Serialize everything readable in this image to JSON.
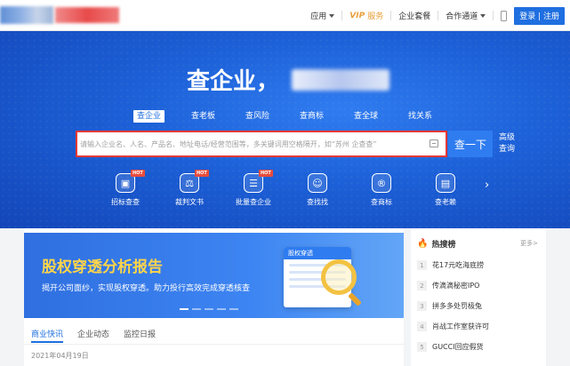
{
  "topbar": {
    "nav": [
      {
        "label": "应用",
        "caret": true
      },
      {
        "vip": "VIP",
        "label": "服务"
      },
      {
        "label": "企业套餐"
      },
      {
        "label": "合作通道",
        "caret": true
      }
    ],
    "login": "登录 | 注册"
  },
  "hero": {
    "title": "查企业，",
    "tabs": [
      "查企业",
      "查老板",
      "查风险",
      "查商标",
      "查全球",
      "找关系"
    ],
    "search_placeholder": "请输入企业名、人名、产品名、地址电话/经营范围等，多关键词用空格隔开，如“苏州 企查查”",
    "search_button": "查一下",
    "advanced": "高级查询",
    "icons": [
      {
        "label": "招标查查",
        "icon": "bid-icon",
        "glyph": "▣",
        "hot": true
      },
      {
        "label": "裁判文书",
        "icon": "judgment-icon",
        "glyph": "⚖",
        "hot": true
      },
      {
        "label": "批量查企业",
        "icon": "batch-icon",
        "glyph": "☰",
        "hot": true
      },
      {
        "label": "查找找",
        "icon": "find-people-icon",
        "glyph": "☺",
        "hot": false
      },
      {
        "label": "查商标",
        "icon": "trademark-icon",
        "glyph": "®",
        "hot": false
      },
      {
        "label": "查老赖",
        "icon": "deadbeat-icon",
        "glyph": "▤",
        "hot": false
      }
    ],
    "hot_badge": "HOT"
  },
  "banner": {
    "title": "股权穿透分析报告",
    "subtitle": "揭开公司面纱，实现股权穿透。助力投行高效完成穿透核查",
    "doc_label": "股权穿透"
  },
  "content": {
    "tabs": [
      "商业快讯",
      "企业动态",
      "监控日报"
    ],
    "date": "2021年04月19日"
  },
  "hotlist": {
    "title": "热搜榜",
    "more": "更多>",
    "items": [
      {
        "num": "1",
        "text": "花17元吃海底捞"
      },
      {
        "num": "2",
        "text": "传滴滴秘密IPO"
      },
      {
        "num": "3",
        "text": "拼多多处罚极兔"
      },
      {
        "num": "4",
        "text": "肖战工作室获许可"
      },
      {
        "num": "5",
        "text": "GUCCI回应假货"
      }
    ]
  },
  "colors": {
    "brand": "#1f6fe0",
    "hero": "#1c5fd6",
    "accent_red": "#e53935",
    "banner_title": "#ffd54a"
  }
}
